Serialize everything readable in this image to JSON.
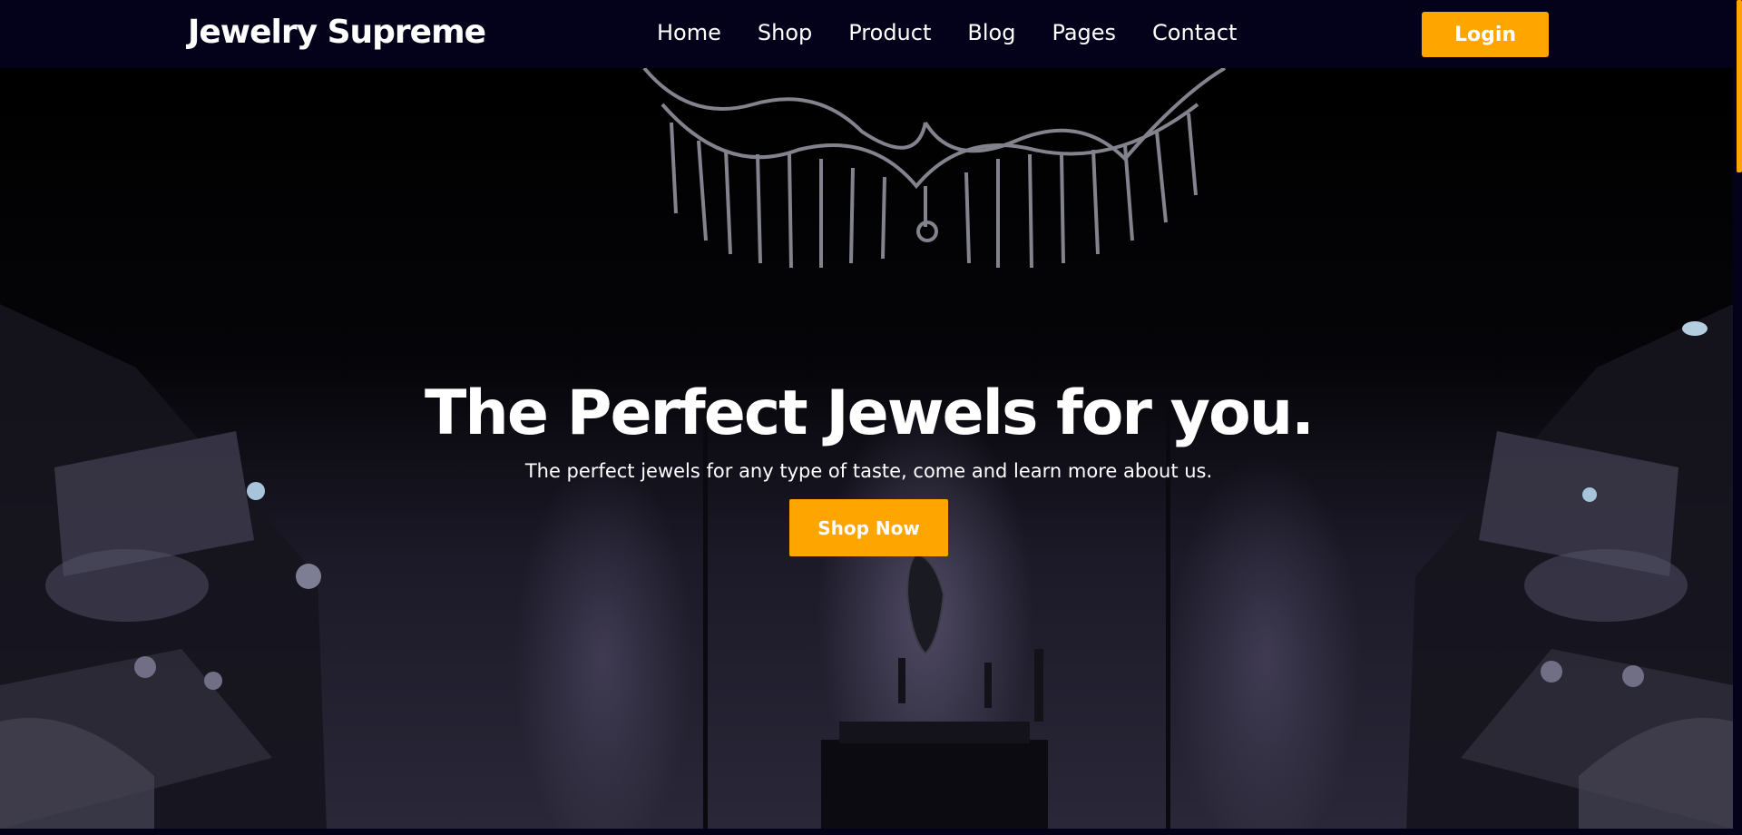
{
  "navbar": {
    "brand": "Jewelry Supreme",
    "links": [
      "Home",
      "Shop",
      "Product",
      "Blog",
      "Pages",
      "Contact"
    ],
    "login_label": "Login"
  },
  "hero": {
    "title": "The Perfect Jewels for you.",
    "subtitle": "The perfect jewels for any type of taste, come and learn more about us.",
    "cta_label": "Shop Now",
    "background": "dark jewelry showroom with chandelier and display cases"
  },
  "colors": {
    "navbar_bg": "#04021a",
    "accent": "#ffa500",
    "text": "#ffffff"
  }
}
